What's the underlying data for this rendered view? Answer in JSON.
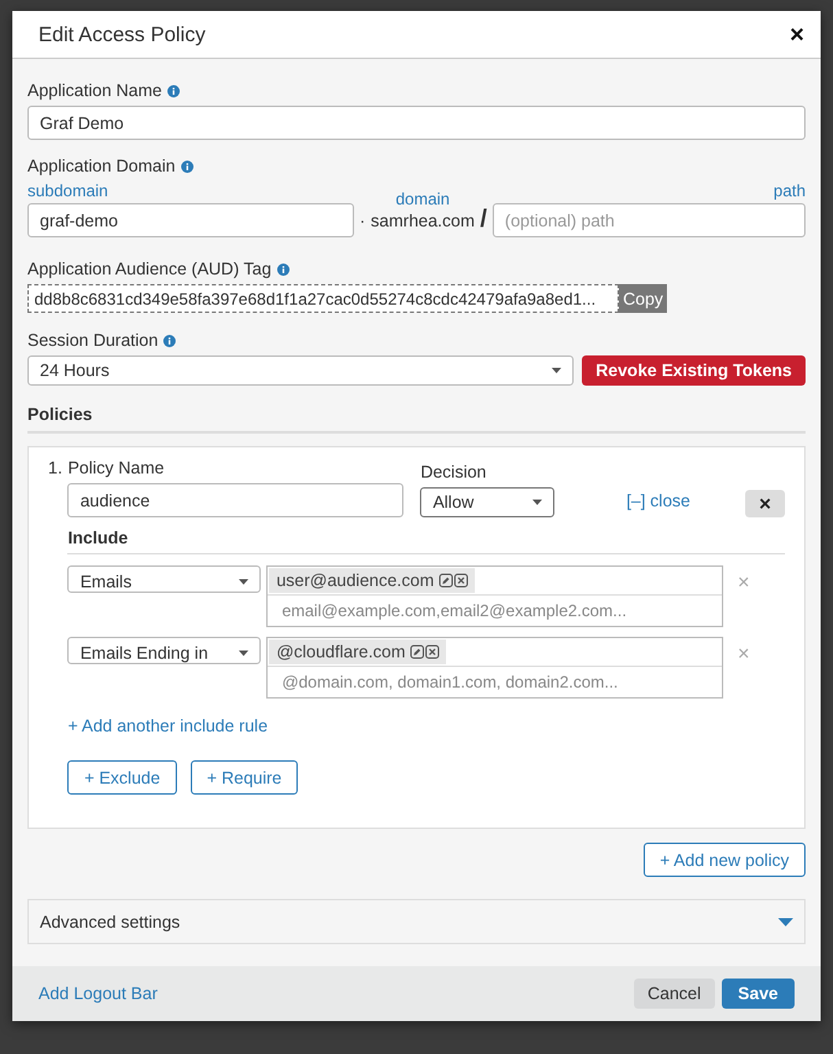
{
  "dialog": {
    "title": "Edit Access Policy",
    "close": "×"
  },
  "app_name": {
    "label": "Application Name",
    "value": "Graf Demo"
  },
  "domain": {
    "label": "Application Domain",
    "subdomain_label": "subdomain",
    "subdomain_value": "graf-demo",
    "separator": "·",
    "domain_label": "domain",
    "domain_value": "samrhea.com",
    "slash": "/",
    "path_label": "path",
    "path_placeholder": "(optional) path"
  },
  "aud": {
    "label": "Application Audience (AUD) Tag",
    "value": "dd8b8c6831cd349e58fa397e68d1f1a27cac0d55274c8cdc42479afa9a8ed1...",
    "copy": "Copy"
  },
  "session": {
    "label": "Session Duration",
    "value": "24 Hours",
    "revoke": "Revoke Existing Tokens"
  },
  "policies_heading": "Policies",
  "policies": [
    {
      "number": "1.",
      "name_label": "Policy Name",
      "name_value": "audience",
      "decision_label": "Decision",
      "decision_value": "Allow",
      "close_link": "[–] close",
      "remove": "×",
      "include_heading": "Include",
      "rules": [
        {
          "type": "Emails",
          "tags": [
            "user@audience.com"
          ],
          "placeholder": "email@example.com,email2@example2.com...",
          "remove": "×"
        },
        {
          "type": "Emails Ending in",
          "tags": [
            "@cloudflare.com"
          ],
          "placeholder": "@domain.com, domain1.com, domain2.com...",
          "remove": "×"
        }
      ],
      "add_rule": "+ Add another include rule",
      "buttons": [
        "+ Exclude",
        "+ Require"
      ]
    }
  ],
  "add_policy": "+ Add new policy",
  "advanced": {
    "label": "Advanced settings",
    "expanded": false
  },
  "footer": {
    "link": "Add Logout Bar",
    "cancel": "Cancel",
    "save": "Save"
  }
}
